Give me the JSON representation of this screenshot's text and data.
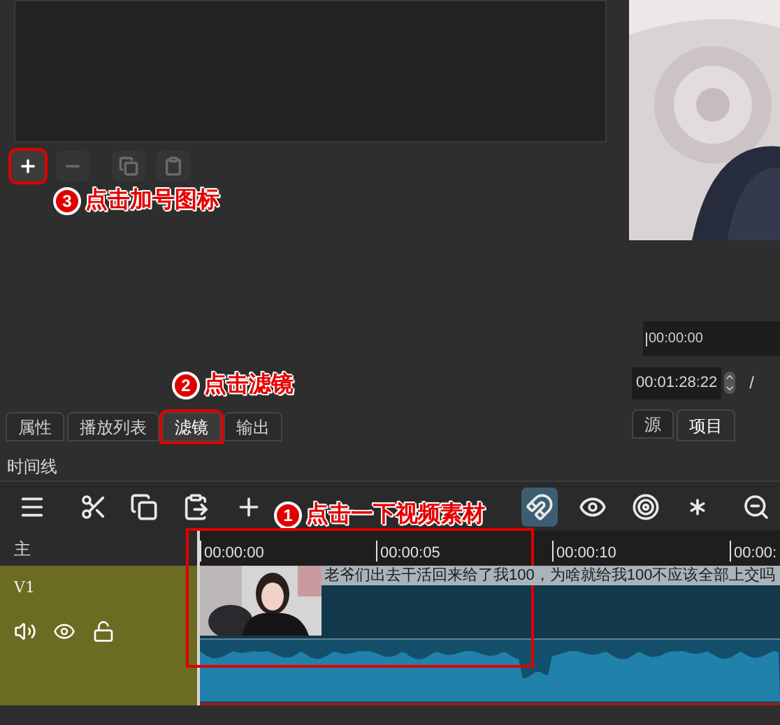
{
  "filters": {
    "buttons": [
      {
        "kind": "add",
        "disabled": false,
        "highlighted": true
      },
      {
        "kind": "remove",
        "disabled": true,
        "highlighted": false
      },
      {
        "kind": "copy",
        "disabled": true,
        "highlighted": false
      },
      {
        "kind": "paste",
        "disabled": true,
        "highlighted": false
      }
    ],
    "annotation": {
      "number": "3",
      "text": "点击加号图标"
    }
  },
  "preview": {
    "ruler_label": "00:00:00",
    "timecode": "00:01:28:22",
    "separator": "/"
  },
  "left_tabs": [
    {
      "label": "属性",
      "selected": false,
      "highlighted": false
    },
    {
      "label": "播放列表",
      "selected": false,
      "highlighted": false
    },
    {
      "label": "滤镜",
      "selected": true,
      "highlighted": true
    },
    {
      "label": "输出",
      "selected": false,
      "highlighted": false
    }
  ],
  "tabs_annotation": {
    "number": "2",
    "text": "点击滤镜"
  },
  "right_tabs": [
    {
      "label": "源",
      "selected": false
    },
    {
      "label": "项目",
      "selected": true
    }
  ],
  "timeline": {
    "title": "时间线",
    "toolbar": [
      {
        "kind": "menu",
        "on": false
      },
      {
        "kind": "cut",
        "on": false
      },
      {
        "kind": "copy",
        "on": false
      },
      {
        "kind": "paste",
        "on": false
      },
      {
        "kind": "append",
        "on": false
      },
      {
        "kind": "snap",
        "on": true
      },
      {
        "kind": "scrub",
        "on": false
      },
      {
        "kind": "ripple",
        "on": false
      },
      {
        "kind": "ripple-all",
        "on": false
      },
      {
        "kind": "zoom-out",
        "on": false
      }
    ],
    "annotation": {
      "number": "1",
      "text": "点击一下视频素材"
    },
    "master_label": "主",
    "ticks": [
      "00:00:00",
      "00:00:05",
      "00:00:10",
      "00:00:"
    ],
    "track": {
      "name": "V1",
      "muted": false,
      "hidden": false,
      "locked": false,
      "clip": {
        "title": "老爷们出去干活回来给了我100，为啥就给我100不应该全部上交吗",
        "highlighted": true
      }
    }
  }
}
